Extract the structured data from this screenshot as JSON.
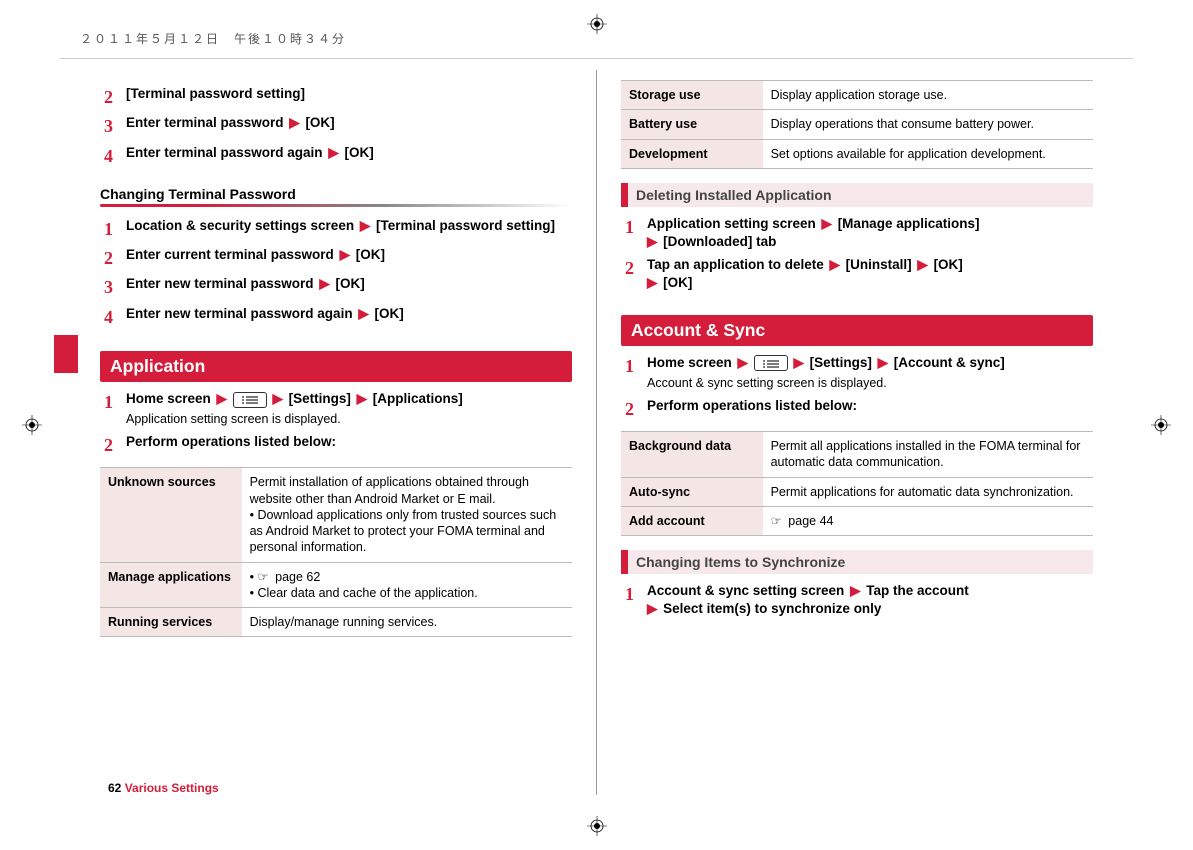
{
  "header": {
    "datetime": "２０１１年５月１２日　午後１０時３４分"
  },
  "left": {
    "steps_top": [
      {
        "num": "2",
        "text": "[Terminal password setting]"
      },
      {
        "num": "3",
        "parts": [
          "Enter terminal password ",
          "▶",
          " [OK]"
        ]
      },
      {
        "num": "4",
        "parts": [
          "Enter terminal password again ",
          "▶",
          " [OK]"
        ]
      }
    ],
    "subhead1": "Changing Terminal Password",
    "steps_change": [
      {
        "num": "1",
        "parts_wrap": [
          "Location & security settings screen ",
          "▶",
          " [Terminal password setting]"
        ]
      },
      {
        "num": "2",
        "parts": [
          "Enter current terminal password ",
          "▶",
          " [OK]"
        ]
      },
      {
        "num": "3",
        "parts": [
          "Enter new terminal password ",
          "▶",
          " [OK]"
        ]
      },
      {
        "num": "4",
        "parts": [
          "Enter new terminal password again ",
          "▶",
          " [OK]"
        ]
      }
    ],
    "title_application": "Application",
    "app_steps": [
      {
        "num": "1",
        "parts": [
          "Home screen ",
          "▶",
          " ",
          "MENU",
          " ",
          "▶",
          " [Settings] ",
          "▶",
          " [Applications]"
        ],
        "note": "Application setting screen is displayed."
      },
      {
        "num": "2",
        "text": "Perform operations listed below:"
      }
    ],
    "table_app": [
      {
        "k": "Unknown sources",
        "v": "Permit installation of applications obtained through website other than Android Market or E mail.\n• Download applications only from trusted sources such as Android Market to protect your FOMA terminal and personal information."
      },
      {
        "k": "Manage applications",
        "v": "• ☞ page 62\n• Clear data and cache of the application."
      },
      {
        "k": "Running services",
        "v": "Display/manage running services."
      }
    ]
  },
  "right": {
    "table_top": [
      {
        "k": "Storage use",
        "v": "Display application storage use."
      },
      {
        "k": "Battery use",
        "v": "Display operations that consume battery power."
      },
      {
        "k": "Development",
        "v": "Set options available for application development."
      }
    ],
    "subhead_delete": "Deleting Installed Application",
    "delete_steps": [
      {
        "num": "1",
        "parts": [
          "Application setting screen ",
          "▶",
          " [Manage applications] "
        ],
        "cont": [
          "▶",
          " [Downloaded] tab"
        ]
      },
      {
        "num": "2",
        "parts": [
          "Tap an application to delete ",
          "▶",
          " [Uninstall] ",
          "▶",
          " [OK] "
        ],
        "cont": [
          "▶",
          " [OK]"
        ]
      }
    ],
    "title_account": "Account & Sync",
    "account_steps": [
      {
        "num": "1",
        "parts": [
          "Home screen ",
          "▶",
          " ",
          "MENU",
          " ",
          "▶",
          " [Settings] ",
          "▶",
          " [Account & sync]"
        ],
        "note": "Account & sync setting screen is displayed."
      },
      {
        "num": "2",
        "text": "Perform operations listed below:"
      }
    ],
    "table_account": [
      {
        "k": "Background data",
        "v": "Permit all applications installed in the FOMA terminal for automatic data communication."
      },
      {
        "k": "Auto-sync",
        "v": "Permit applications for automatic data synchronization."
      },
      {
        "k": "Add account",
        "v": "☞ page 44"
      }
    ],
    "subhead_sync": "Changing Items to Synchronize",
    "sync_steps": [
      {
        "num": "1",
        "parts": [
          "Account & sync setting screen ",
          "▶",
          " Tap the account "
        ],
        "cont": [
          "▶",
          " Select item(s) to synchronize only"
        ]
      }
    ]
  },
  "footer": {
    "page_num": "62",
    "section": " Various Settings"
  }
}
